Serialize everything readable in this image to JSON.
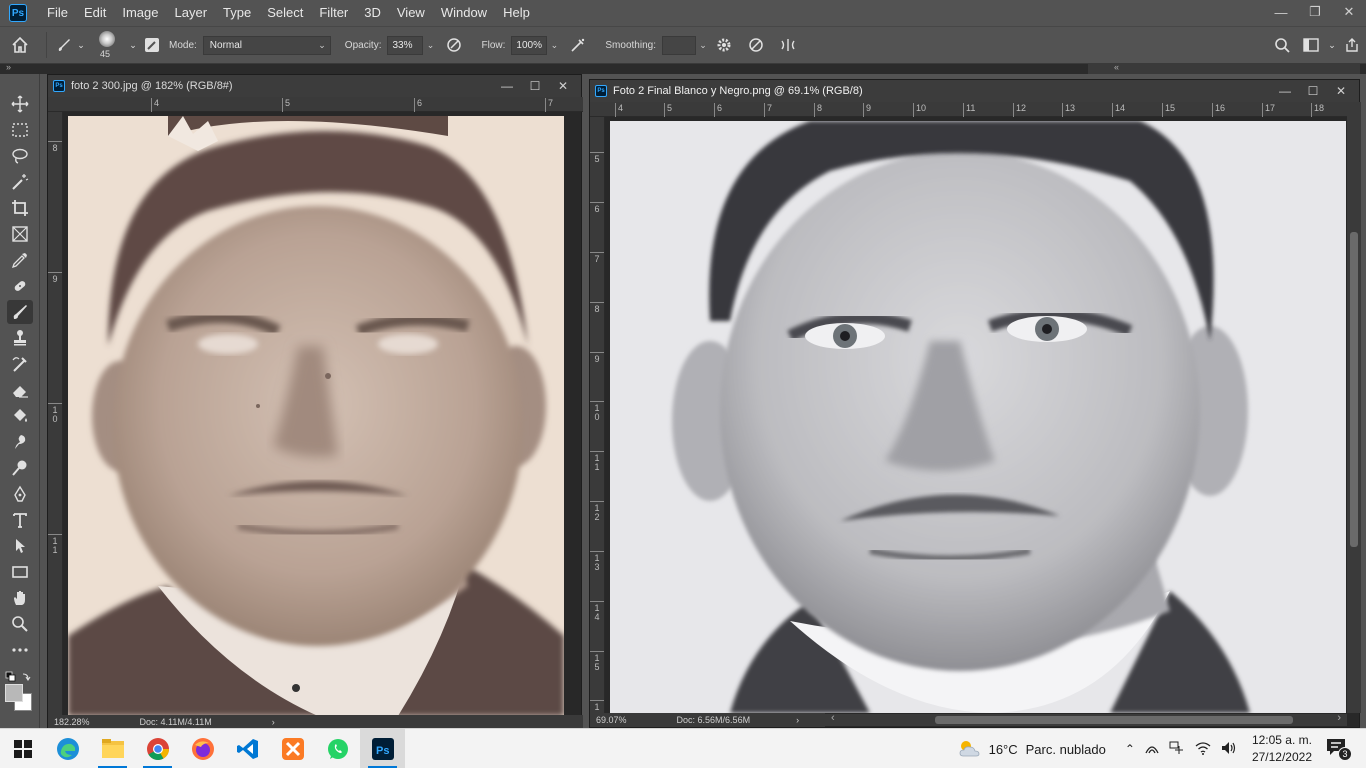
{
  "app": {
    "logo_text": "Ps"
  },
  "menu": [
    "File",
    "Edit",
    "Image",
    "Layer",
    "Type",
    "Select",
    "Filter",
    "3D",
    "View",
    "Window",
    "Help"
  ],
  "window_controls": {
    "minimize": "—",
    "restore": "❐",
    "close": "✕"
  },
  "options": {
    "brush_size": "45",
    "mode_label": "Mode:",
    "mode_value": "Normal",
    "opacity_label": "Opacity:",
    "opacity_value": "33%",
    "flow_label": "Flow:",
    "flow_value": "100%",
    "smoothing_label": "Smoothing:",
    "smoothing_value": ""
  },
  "tools": [
    "move-tool",
    "marquee-tool",
    "lasso-tool",
    "magic-wand-tool",
    "crop-tool",
    "frame-tool",
    "eyedropper-tool",
    "healing-brush-tool",
    "brush-tool",
    "clone-stamp-tool",
    "history-brush-tool",
    "eraser-tool",
    "paint-bucket-tool",
    "smudge-tool",
    "dodge-tool",
    "pen-tool",
    "type-tool",
    "path-selection-tool",
    "rectangle-tool",
    "hand-tool",
    "zoom-tool",
    "more-tools"
  ],
  "doc_left": {
    "title": "foto 2 300.jpg @ 182% (RGB/8#)",
    "ruler_h": [
      "4",
      "5",
      "6",
      "7"
    ],
    "ruler_v": [
      "8",
      "9",
      "1\n0",
      "1\n1"
    ],
    "zoom": "182.28%",
    "doc_size": "Doc: 4.11M/4.11M",
    "arrow": "›"
  },
  "doc_right": {
    "title": "Foto 2 Final Blanco y Negro.png @ 69.1% (RGB/8)",
    "ruler_h": [
      "4",
      "5",
      "6",
      "7",
      "8",
      "9",
      "10",
      "11",
      "12",
      "13",
      "14",
      "15",
      "16",
      "17",
      "18"
    ],
    "ruler_v": [
      "5",
      "6",
      "7",
      "8",
      "9",
      "1\n0",
      "1\n1",
      "1\n2",
      "1\n3",
      "1\n4",
      "1\n5",
      "1"
    ],
    "zoom": "69.07%",
    "doc_size": "Doc: 6.56M/6.56M",
    "arrow": "›",
    "scroll_left": "‹",
    "scroll_right": "›"
  },
  "taskbar": {
    "apps": [
      "windows-start",
      "edge",
      "file-explorer",
      "chrome",
      "firefox",
      "vscode",
      "xampp",
      "whatsapp",
      "photoshop"
    ],
    "weather_temp": "16°C",
    "weather_desc": "Parc. nublado",
    "time": "12:05 a. m.",
    "date": "27/12/2022",
    "notifications": "3"
  },
  "colors": {
    "ui_bg": "#535353",
    "canvas_bg": "#282828",
    "accent": "#31a8ff",
    "taskbar_bg": "#f3f3f3"
  }
}
